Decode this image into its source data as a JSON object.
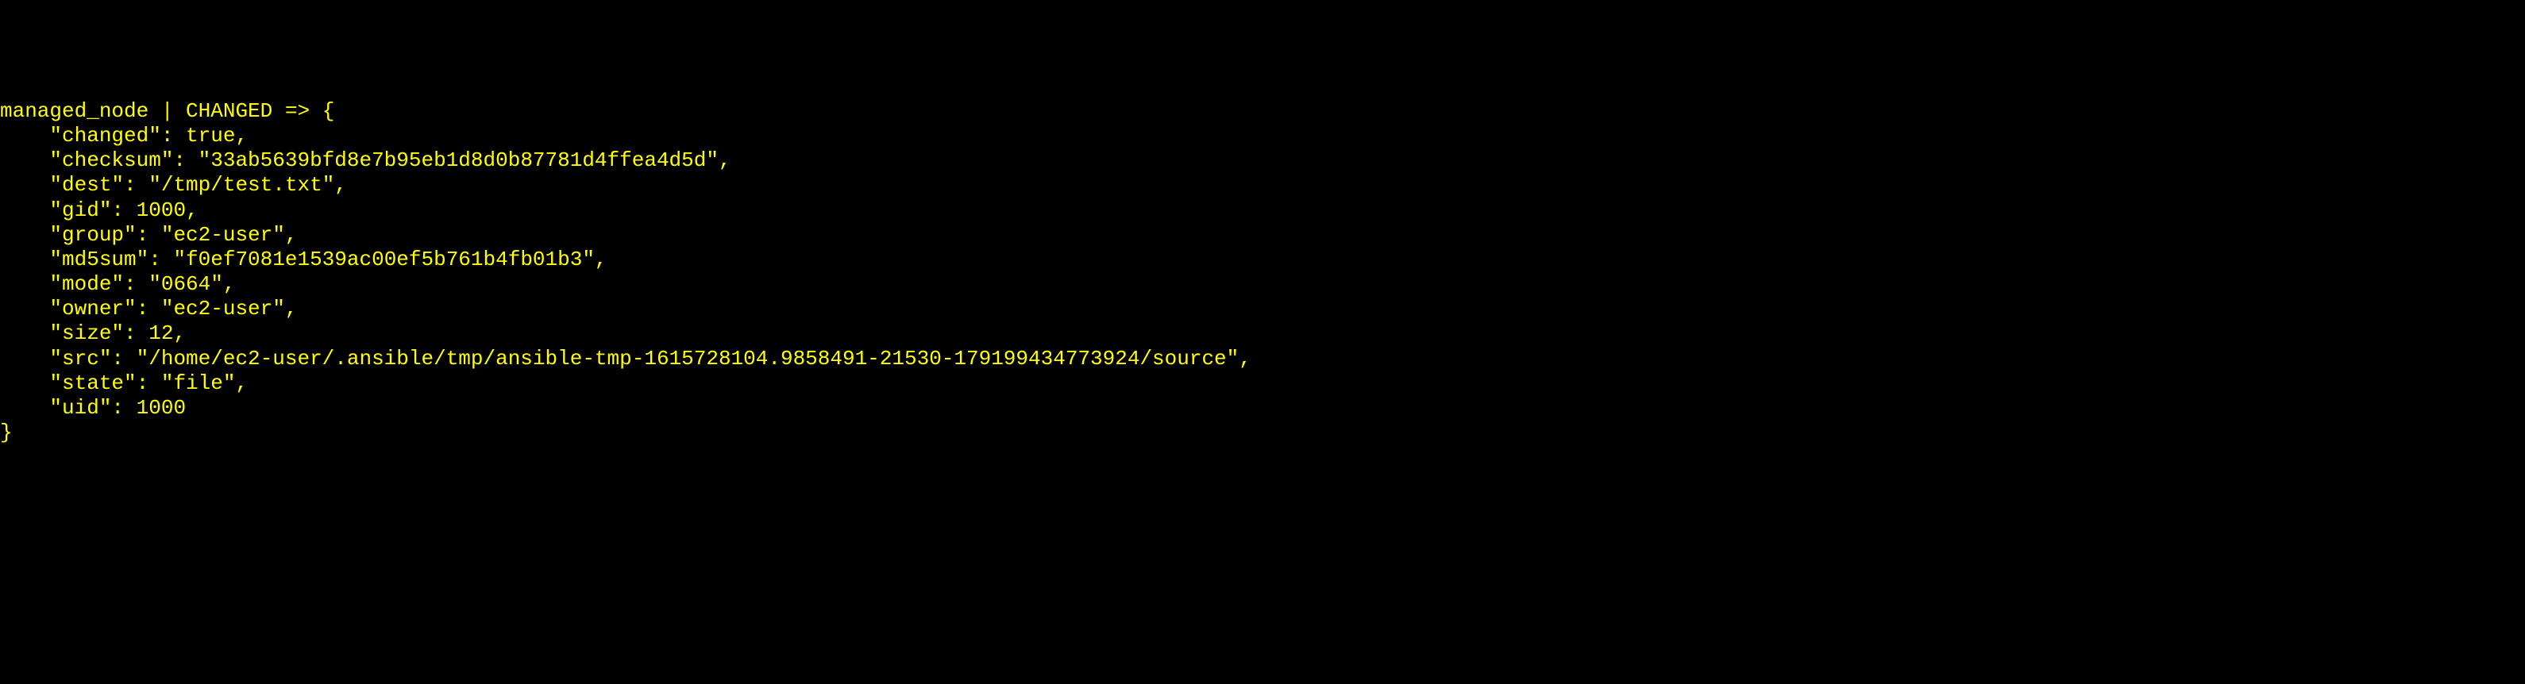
{
  "output": {
    "host": "managed_node",
    "status": "CHANGED",
    "arrow": "=>",
    "result": {
      "changed": "true",
      "checksum": "33ab5639bfd8e7b95eb1d8d0b87781d4ffea4d5d",
      "dest": "/tmp/test.txt",
      "gid": "1000",
      "group": "ec2-user",
      "md5sum": "f0ef7081e1539ac00ef5b761b4fb01b3",
      "mode": "0664",
      "owner": "ec2-user",
      "size": "12",
      "src": "/home/ec2-user/.ansible/tmp/ansible-tmp-1615728104.9858491-21530-179199434773924/source",
      "state": "file",
      "uid": "1000"
    }
  }
}
